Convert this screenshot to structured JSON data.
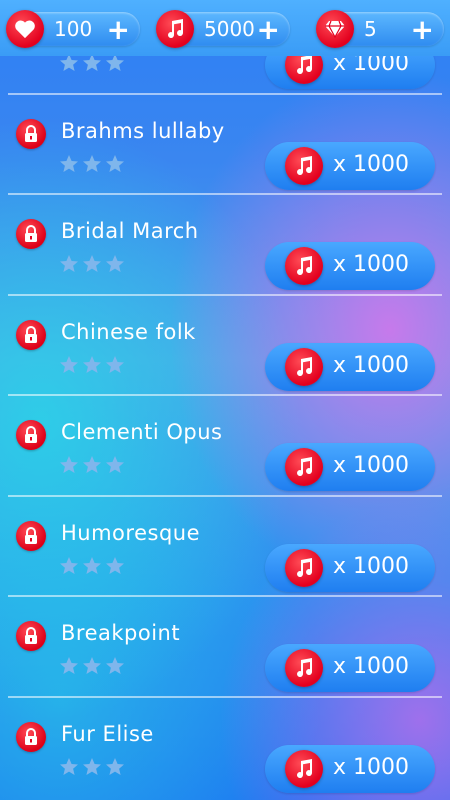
{
  "currency": {
    "lives": {
      "value": "100",
      "plus": "+",
      "icon": "heart-icon"
    },
    "notes": {
      "value": "5000",
      "plus": "+",
      "icon": "music-note-icon"
    },
    "gems": {
      "value": "5",
      "plus": "+",
      "icon": "diamond-icon"
    }
  },
  "colors": {
    "accent_red": "#e3001e",
    "button_blue": "#2f8cf0",
    "star": "#7fb6ec"
  },
  "songs": [
    {
      "title": "",
      "stars": 3,
      "price": "x 1000",
      "locked": true,
      "price_icon": "music-note-icon"
    },
    {
      "title": "Brahms lullaby",
      "stars": 3,
      "price": "x 1000",
      "locked": true,
      "price_icon": "music-note-icon"
    },
    {
      "title": "Bridal March",
      "stars": 3,
      "price": "x 1000",
      "locked": true,
      "price_icon": "music-note-icon"
    },
    {
      "title": "Chinese folk",
      "stars": 3,
      "price": "x 1000",
      "locked": true,
      "price_icon": "music-note-icon"
    },
    {
      "title": "Clementi Opus",
      "stars": 3,
      "price": "x 1000",
      "locked": true,
      "price_icon": "music-note-icon"
    },
    {
      "title": "Humoresque",
      "stars": 3,
      "price": "x 1000",
      "locked": true,
      "price_icon": "music-note-icon"
    },
    {
      "title": "Breakpoint",
      "stars": 3,
      "price": "x 1000",
      "locked": true,
      "price_icon": "music-note-icon"
    },
    {
      "title": "Fur Elise",
      "stars": 3,
      "price": "x 1000",
      "locked": true,
      "price_icon": "music-note-icon"
    }
  ]
}
